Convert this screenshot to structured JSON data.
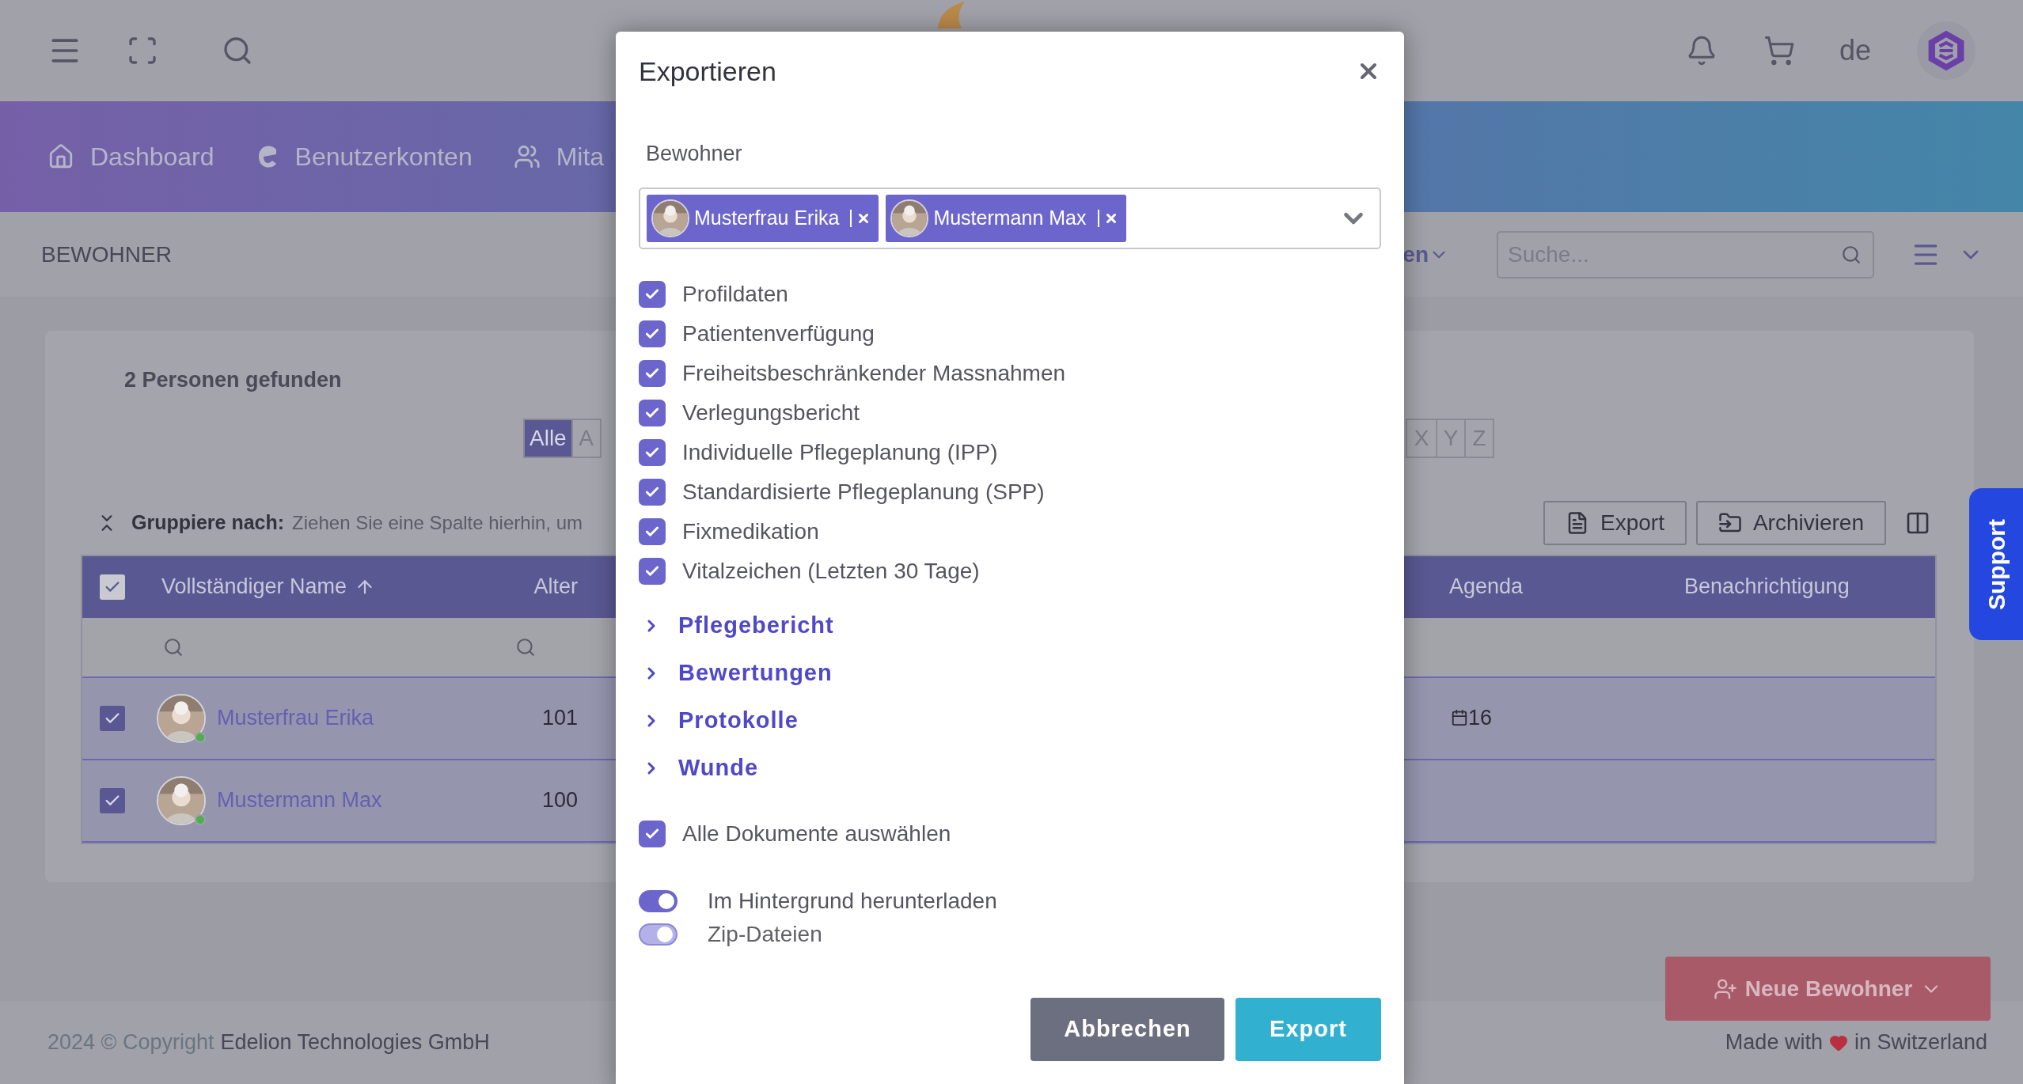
{
  "header": {
    "language": "de"
  },
  "nav": {
    "items": [
      {
        "label": "Dashboard"
      },
      {
        "label": "Benutzerkonten"
      },
      {
        "label": "Mita"
      }
    ]
  },
  "subheader": {
    "title": "BEWOHNER",
    "dropdown_text": "en",
    "search": {
      "placeholder": "Suche..."
    }
  },
  "content": {
    "count": "2 Personen gefunden",
    "alphabet_left": [
      {
        "label": "Alle",
        "selected": true
      },
      {
        "label": "A",
        "selected": false
      }
    ],
    "alphabet_right": [
      {
        "label": "X",
        "selected": false
      },
      {
        "label": "Y",
        "selected": false
      },
      {
        "label": "Z",
        "selected": false
      }
    ],
    "group_by": {
      "label": "Gruppiere nach:",
      "hint": "Ziehen Sie eine Spalte hierhin, um"
    },
    "toolbar": [
      "Export",
      "Archivieren"
    ],
    "table": {
      "all_checked": true,
      "columns": [
        {
          "label": "Vollständiger Name",
          "sorted_ascending": true
        },
        {
          "label": "Alter",
          "sorted_ascending": false
        },
        {
          "label": "Agenda",
          "sorted_ascending": false
        },
        {
          "label": "Benachrichtigung",
          "sorted_ascending": false
        }
      ],
      "rows": [
        {
          "name": "Musterfrau Erika",
          "age": "101",
          "agenda": "16",
          "checked": true,
          "online": true
        },
        {
          "name": "Mustermann Max",
          "age": "100",
          "agenda": "",
          "checked": true,
          "online": true
        }
      ]
    }
  },
  "modal": {
    "title": "Exportieren",
    "residents_label": "Bewohner",
    "selected_residents": [
      {
        "name": "Musterfrau Erika"
      },
      {
        "name": "Mustermann Max"
      }
    ],
    "documents": [
      {
        "label": "Profildaten",
        "checked": true
      },
      {
        "label": "Patientenverfügung",
        "checked": true
      },
      {
        "label": "Freiheitsbeschränkender Massnahmen",
        "checked": true
      },
      {
        "label": "Verlegungsbericht",
        "checked": true
      },
      {
        "label": "Individuelle Pflegeplanung (IPP)",
        "checked": true
      },
      {
        "label": "Standardisierte Pflegeplanung (SPP)",
        "checked": true
      },
      {
        "label": "Fixmedikation",
        "checked": true
      },
      {
        "label": "Vitalzeichen (Letzten 30 Tage)",
        "checked": true
      }
    ],
    "sections": [
      {
        "label": "Pflegebericht",
        "expanded": false
      },
      {
        "label": "Bewertungen",
        "expanded": false
      },
      {
        "label": "Protokolle",
        "expanded": false
      },
      {
        "label": "Wunde",
        "expanded": false
      }
    ],
    "select_all": {
      "label": "Alle Dokumente auswählen",
      "checked": true
    },
    "toggles": [
      {
        "label": "Im Hintergrund herunterladen",
        "on": true,
        "disabled": false
      },
      {
        "label": "Zip-Dateien",
        "on": true,
        "disabled": true
      }
    ],
    "buttons": [
      {
        "label": "Abbrechen",
        "kind": "secondary"
      },
      {
        "label": "Export",
        "kind": "primary"
      }
    ]
  },
  "fab": {
    "label": "Neue Bewohner"
  },
  "support": {
    "label": "Support"
  },
  "footer": {
    "copyright": "2024 © Copyright",
    "company": "Edelion Technologies GmbH",
    "made_with": "Made with",
    "made_in": "in Switzerland"
  }
}
